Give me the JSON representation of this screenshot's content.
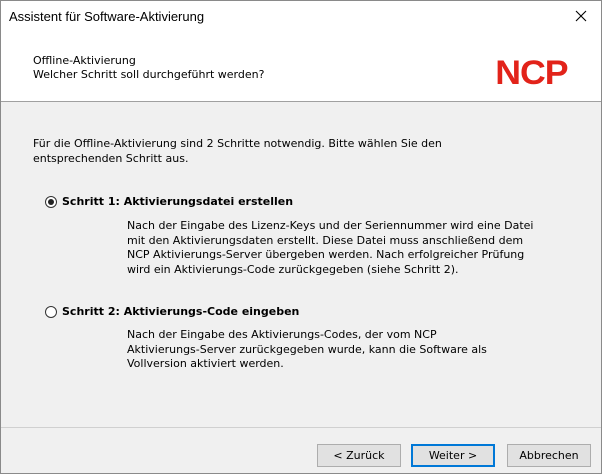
{
  "window": {
    "title": "Assistent für Software-Aktivierung",
    "close_glyph": "✕"
  },
  "header": {
    "title": "Offline-Aktivierung",
    "subtitle": "Welcher Schritt soll durchgeführt werden?",
    "logo": "NCP",
    "logo_color": "#e2231a"
  },
  "main": {
    "intro_line1": "Für die Offline-Aktivierung sind 2 Schritte notwendig. Bitte wählen Sie den",
    "intro_line2": "entsprechenden Schritt aus.",
    "options": [
      {
        "label": "Schritt 1:  Aktivierungsdatei erstellen",
        "selected": true,
        "desc": [
          "Nach der Eingabe des Lizenz-Keys und der Seriennummer wird eine Datei",
          "mit den Aktivierungsdaten erstellt. Diese Datei muss anschließend dem",
          "NCP Aktivierungs-Server übergeben werden. Nach erfolgreicher Prüfung",
          "wird ein Aktivierungs-Code zurückgegeben (siehe Schritt 2)."
        ]
      },
      {
        "label": "Schritt 2:  Aktivierungs-Code eingeben",
        "selected": false,
        "desc": [
          "Nach der Eingabe des Aktivierungs-Codes, der vom NCP",
          "Aktivierungs-Server zurückgegeben wurde, kann die Software als",
          "Vollversion aktiviert werden."
        ]
      }
    ]
  },
  "buttons": {
    "back": "< Zurück",
    "next": "Weiter >",
    "cancel": "Abbrechen"
  }
}
